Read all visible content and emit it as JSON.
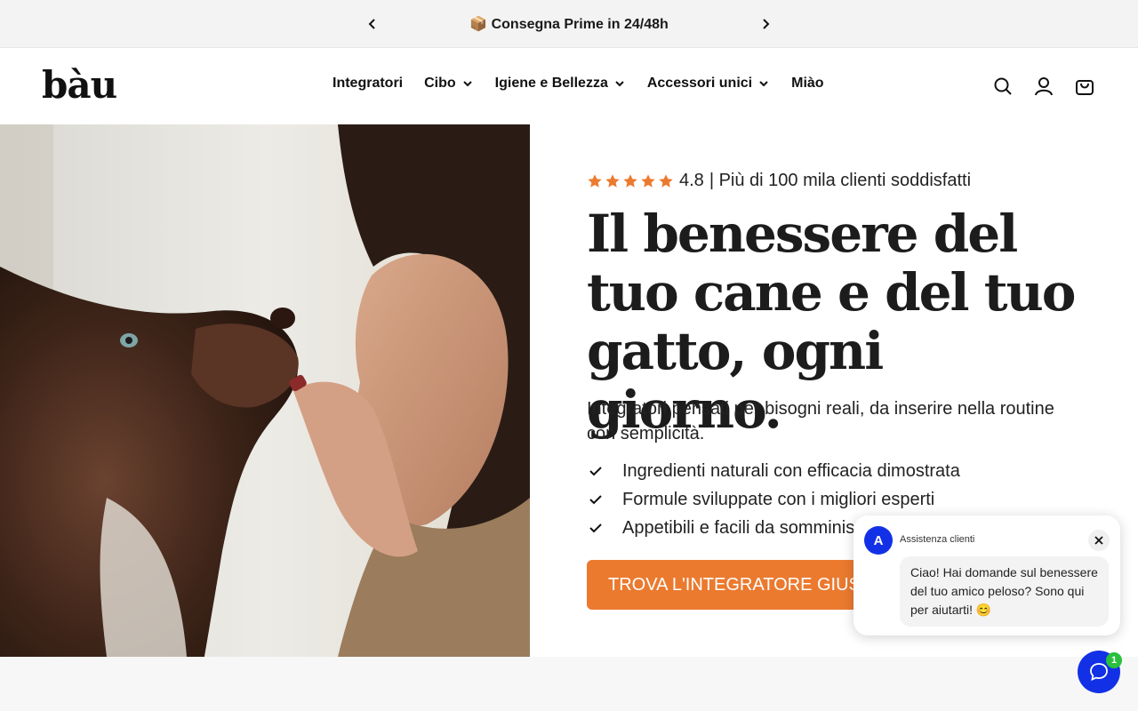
{
  "announcement": {
    "message": "📦 Consegna Prime in 24/48h"
  },
  "header": {
    "logo": "bàu",
    "nav": [
      {
        "label": "Integratori",
        "has_dropdown": false
      },
      {
        "label": "Cibo",
        "has_dropdown": true
      },
      {
        "label": "Igiene e Bellezza",
        "has_dropdown": true
      },
      {
        "label": "Accessori unici",
        "has_dropdown": true
      },
      {
        "label": "Miào",
        "has_dropdown": false
      }
    ],
    "icons": [
      "search-icon",
      "account-icon",
      "cart-icon"
    ]
  },
  "hero": {
    "rating_value": "4.8",
    "rating_text": "| Più di 100 mila clienti soddisfatti",
    "stars": 5,
    "headline": "Il benessere del tuo cane e del tuo gatto, ogni giorno.",
    "subheadline": "Integratori pensati per bisogni reali, da inserire nella routine con semplicità.",
    "bullets": [
      "Ingredienti naturali con efficacia dimostrata",
      "Formule sviluppate con i migliori esperti",
      "Appetibili e facili da somministrare"
    ],
    "cta": "TROVA L'INTEGRATORE GIUSTO"
  },
  "chat": {
    "avatar_letter": "A",
    "agent_name": "Assistenza clienti",
    "message": "Ciao! Hai domande sul benessere del tuo amico peloso? Sono qui per aiutarti! 😊",
    "badge_count": "1"
  },
  "colors": {
    "accent": "#eb7a2f",
    "chat_blue": "#1231e6",
    "badge_green": "#28c03c"
  }
}
